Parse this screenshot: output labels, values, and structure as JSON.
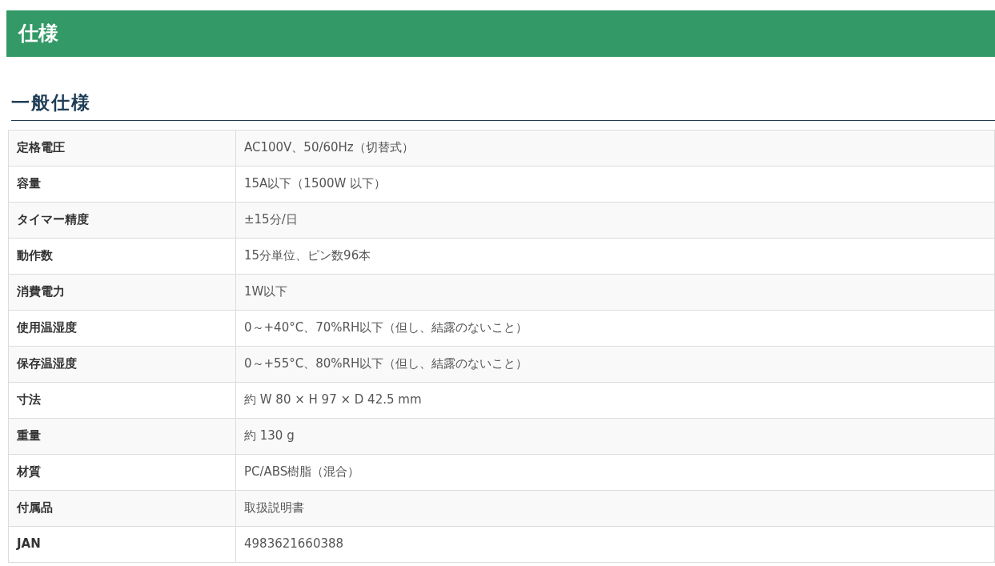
{
  "page_title": "仕様",
  "section_title": "一般仕様",
  "rows": [
    {
      "label": "定格電圧",
      "value": "AC100V、50/60Hz（切替式）"
    },
    {
      "label": "容量",
      "value": "15A以下（1500W 以下）"
    },
    {
      "label": "タイマー精度",
      "value": "±15分/日"
    },
    {
      "label": "動作数",
      "value": "15分単位、ピン数96本"
    },
    {
      "label": "消費電力",
      "value": "1W以下"
    },
    {
      "label": "使用温湿度",
      "value": "0～+40°C、70%RH以下（但し、結露のないこと）"
    },
    {
      "label": "保存温湿度",
      "value": "0～+55°C、80%RH以下（但し、結露のないこと）"
    },
    {
      "label": "寸法",
      "value": "約 W 80 × H 97 × D 42.5 mm"
    },
    {
      "label": "重量",
      "value": "約 130 g"
    },
    {
      "label": "材質",
      "value": "PC/ABS樹脂（混合）"
    },
    {
      "label": "付属品",
      "value": "取扱説明書"
    },
    {
      "label": "JAN",
      "value": "4983621660388"
    }
  ]
}
